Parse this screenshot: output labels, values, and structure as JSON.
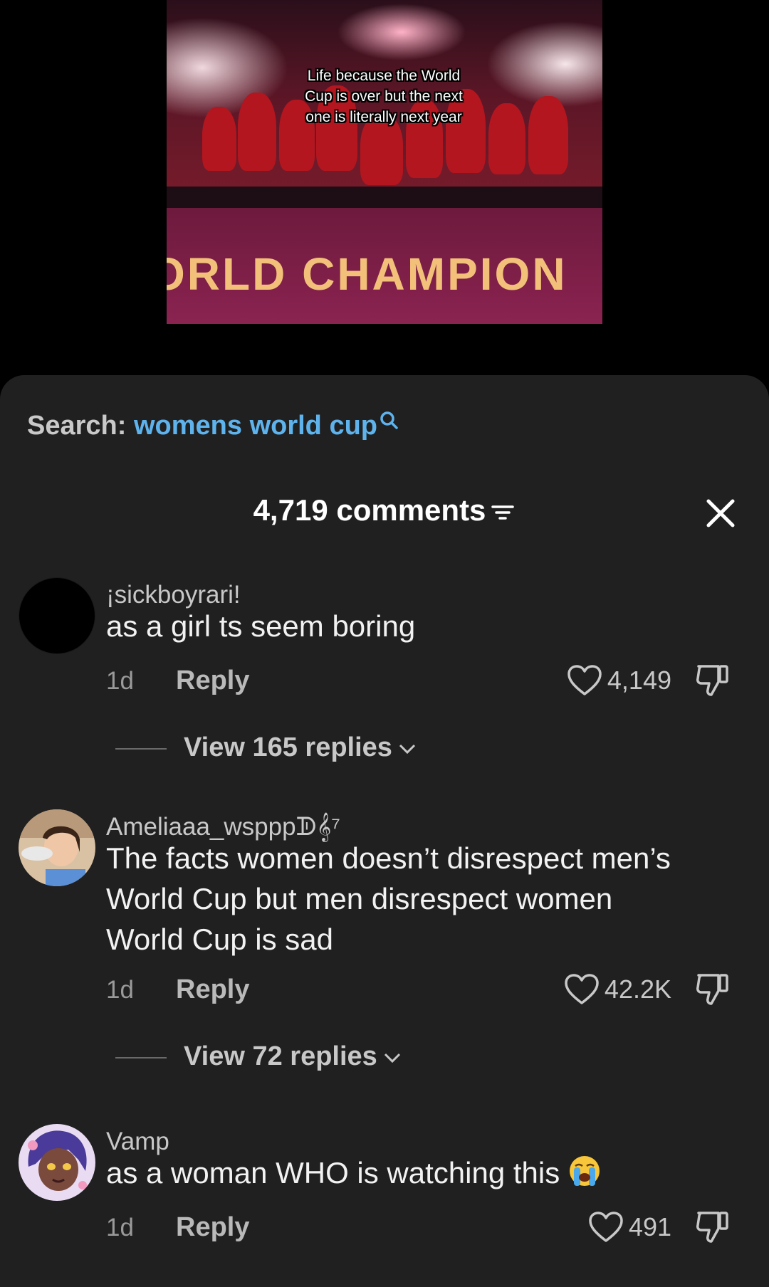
{
  "video": {
    "caption": "Life because the World Cup is over but the next one is literally next year",
    "banner": "ORLD CHAMPION"
  },
  "search": {
    "label": "Search:",
    "query": "womens world cup"
  },
  "comments_header": {
    "count": "4,719 comments"
  },
  "comments": [
    {
      "username": "¡sickboyrari!",
      "text": "as a girl ts seem boring",
      "age": "1d",
      "reply_label": "Reply",
      "likes": "4,149",
      "view_replies": "View 165 replies"
    },
    {
      "username": "Ameliaaa_wspppᗫ𝄞⁷",
      "text": "The facts women doesn’t disrespect men’s World Cup but men disrespect women World Cup is sad",
      "age": "1d",
      "reply_label": "Reply",
      "likes": "42.2K",
      "view_replies": "View 72 replies"
    },
    {
      "username": "Vamp",
      "text": "as a woman WHO is watching this",
      "emoji": "loudly-crying-face",
      "age": "1d",
      "reply_label": "Reply",
      "likes": "491"
    }
  ],
  "colors": {
    "panel_bg": "#202020",
    "search_query": "#5fb3ec",
    "video_banner_bg": "#7a1f3f"
  }
}
